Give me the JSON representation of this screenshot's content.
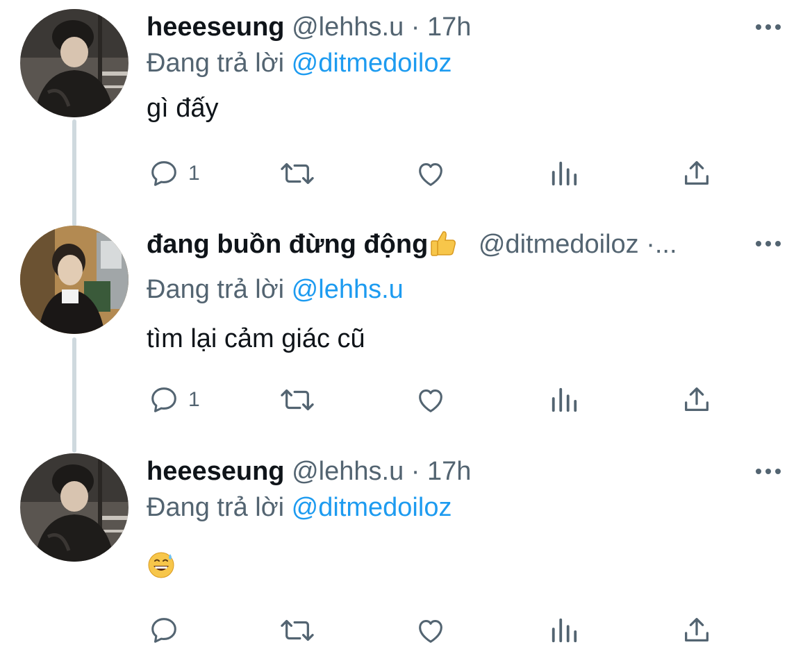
{
  "replying_label": "Đang trả lời",
  "tweets": [
    {
      "display_name": "heeeseung",
      "handle": "@lehhs.u",
      "separator": "·",
      "time": "17h",
      "reply_to": "@ditmedoiloz",
      "text": "gì đấy",
      "reply_count": "1",
      "avatar": "avatar-heeseung"
    },
    {
      "display_name": "đang buồn đừng động",
      "name_emoji": "thumbs-up-emoji",
      "handle": "@ditmedoiloz",
      "handle_suffix": "·...",
      "reply_to": "@lehhs.u",
      "text": "tìm lại cảm giác cũ",
      "reply_count": "1",
      "avatar": "avatar-ditmedoiloz"
    },
    {
      "display_name": "heeeseung",
      "handle": "@lehhs.u",
      "separator": "·",
      "time": "17h",
      "reply_to": "@ditmedoiloz",
      "text_emoji": "grinning-face-with-sweat-emoji",
      "reply_count": "",
      "avatar": "avatar-heeseung"
    }
  ],
  "icons": [
    "reply-icon",
    "retweet-icon",
    "like-icon",
    "analytics-icon",
    "share-icon",
    "more-icon"
  ],
  "colors": {
    "text": "#0f1419",
    "secondary": "#536471",
    "link": "#1d9bf0",
    "thread": "#cfd9de"
  }
}
